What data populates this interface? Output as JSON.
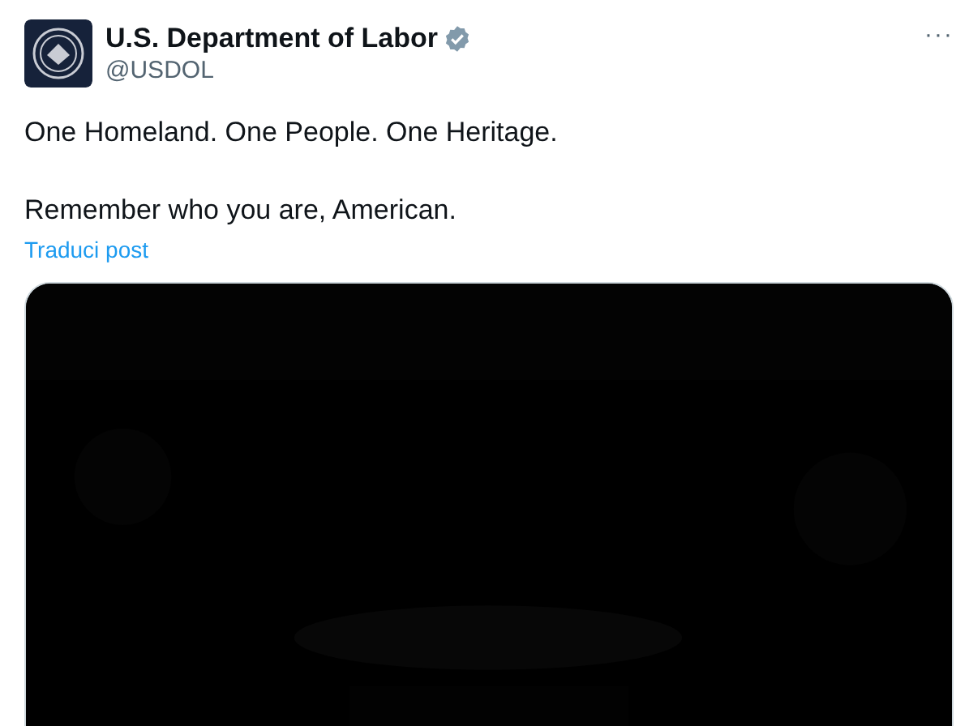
{
  "author": {
    "name": "U.S. Department of Labor",
    "verified": true,
    "handle": "@USDOL"
  },
  "more_button": "···",
  "post": {
    "lines": [
      "One Homeland. One People. One Heritage.",
      "Remember who you are, American."
    ]
  },
  "translate_link": "Traduci post"
}
